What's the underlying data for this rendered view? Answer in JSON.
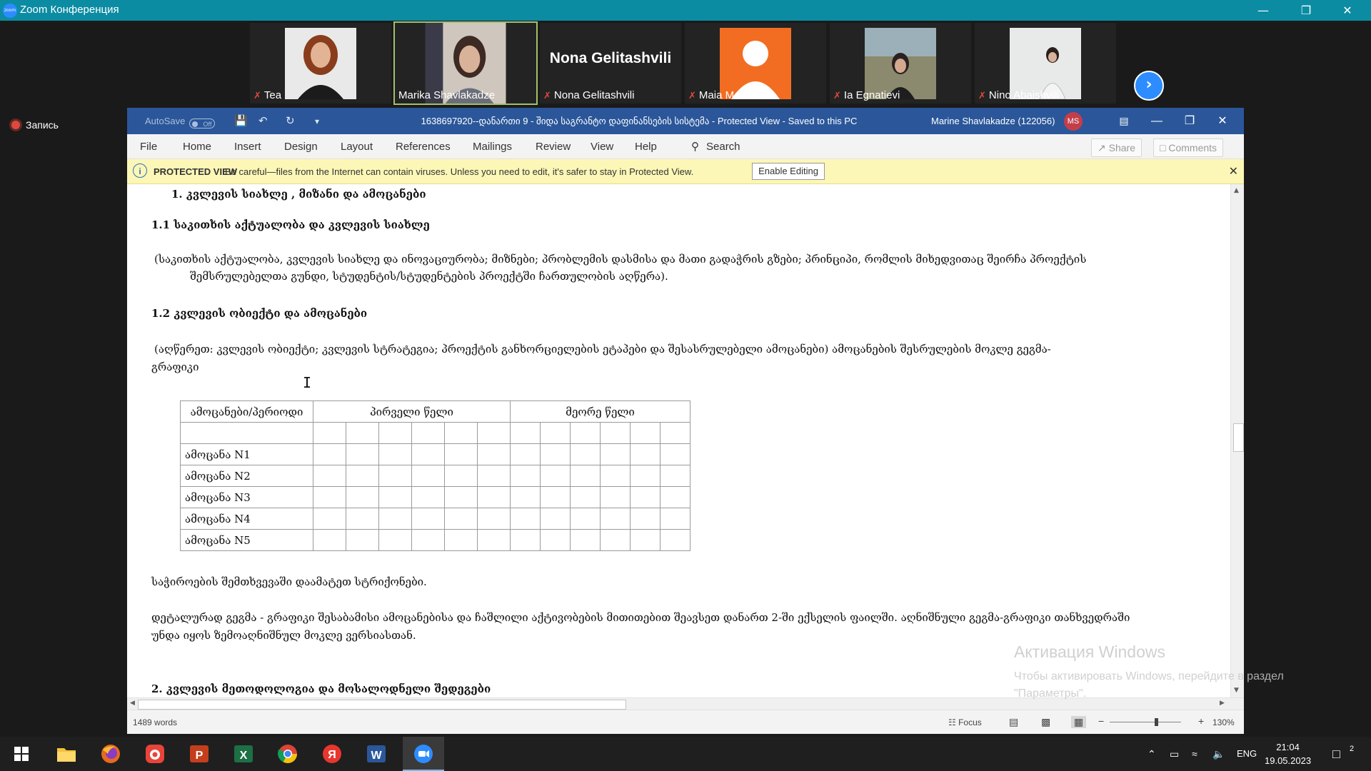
{
  "zoom": {
    "title": "Zoom Конференция",
    "logo_text": "zoom",
    "minimize": "—",
    "restore": "❐",
    "close": "✕",
    "recording_label": "Запись",
    "participants": [
      {
        "name": "Tea"
      },
      {
        "name": "Marika Shavlakadze"
      },
      {
        "name": "Nona Gelitashvili",
        "big_label": "Nona Gelitashvili"
      },
      {
        "name": "Maia Meladze"
      },
      {
        "name": "Ia Egnatievi"
      },
      {
        "name": "Nino Abaishvili"
      }
    ],
    "next_icon": "chevron-right-icon"
  },
  "word": {
    "autosave_label": "AutoSave",
    "autosave_state": "Off",
    "doc_title": "1638697920--დანართი 9 - შიდა საგრანტო დაფინანსების სისტემა  -  Protected View  -  Saved to this PC",
    "user": "Marine Shavlakadze (122056)",
    "user_initials": "MS",
    "menu": [
      "File",
      "Home",
      "Insert",
      "Design",
      "Layout",
      "References",
      "Mailings",
      "Review",
      "View",
      "Help"
    ],
    "search_label": "Search",
    "share_label": "Share",
    "comments_label": "Comments",
    "protected": {
      "label": "PROTECTED VIEW",
      "message": "Be careful—files from the Internet can contain viruses. Unless you need to edit, it's safer to stay in Protected View.",
      "button": "Enable Editing"
    },
    "document": {
      "h1": "1.   კვლევის სიახლე , მიზანი და ამოცანები",
      "h11": "1.1   საკითხის აქტუალობა და კვლევის სიახლე",
      "p1_line1": "(საკითხის აქტუალობა, კვლევის სიახლე და ინოვაციურობა; მიზნები; პრობლემის დასმისა და მათი გადაჭრის გზები; პრინციპი, რომლის მიხედვითაც          შეირჩა   პროექტის",
      "p1_line2": "შემსრულებელთა    გუნდი, სტუდენტის/სტუდენტების პროექტში ჩართულობის აღწერა).",
      "h12": "1.2  კვლევის ობიექტი და ამოცანები",
      "p2_line1": "(აღწერეთ:   კვლევის     ობიექტი;     კვლევის      სტრატეგია;  პროექტის განხორციელების ეტაპები და შესასრულებელი ამოცანები)  ამოცანების შესრულების მოკლე გეგმა-",
      "p2_line2": "გრაფიკი",
      "table": {
        "col_header": "ამოცანები/პერიოდი",
        "year1": "პირველი წელი",
        "year2": "მეორე წელი",
        "rows": [
          "ამოცანა N1",
          "ამოცანა N2",
          "ამოცანა N3",
          "ამოცანა N4",
          "ამოცანა N5"
        ]
      },
      "p3": "საჭიროების შემთხვევაში დაამატეთ სტრიქონები.",
      "p4_line1": "დეტალურად გეგმა - გრაფიკი შესაბამისი ამოცანებისა და ჩაშლილი აქტივობების მითითებით შეავსეთ დანართ  2-ში ექსელის ფაილში. აღნიშნული გეგმა-გრაფიკი თანხვედრაში",
      "p4_line2": "უნდა იყოს ზემოაღნიშნულ მოკლე ვერსიასთან.",
      "h2": "2. კვლევის მეთოდოლოგია და მოსალოდნელი შედეგები"
    },
    "status": {
      "words": "1489 words",
      "focus": "Focus",
      "zoom_level": "130%",
      "zoom_minus": "−",
      "zoom_plus": "+"
    }
  },
  "activation": {
    "title": "Активация Windows",
    "line1": "Чтобы активировать Windows, перейдите в раздел",
    "line2": "\"Параметры\"."
  },
  "taskbar": {
    "lang": "ENG",
    "time": "21:04",
    "date": "19.05.2023",
    "notif_count": "2",
    "apps": [
      "windows-start-icon",
      "file-explorer-icon",
      "firefox-icon",
      "recorder-icon",
      "powerpoint-icon",
      "excel-icon",
      "chrome-icon",
      "yandex-icon",
      "word-icon",
      "zoom-icon"
    ],
    "letters": {
      "powerpoint": "P",
      "excel": "X",
      "word": "W",
      "yandex": "Я"
    }
  }
}
